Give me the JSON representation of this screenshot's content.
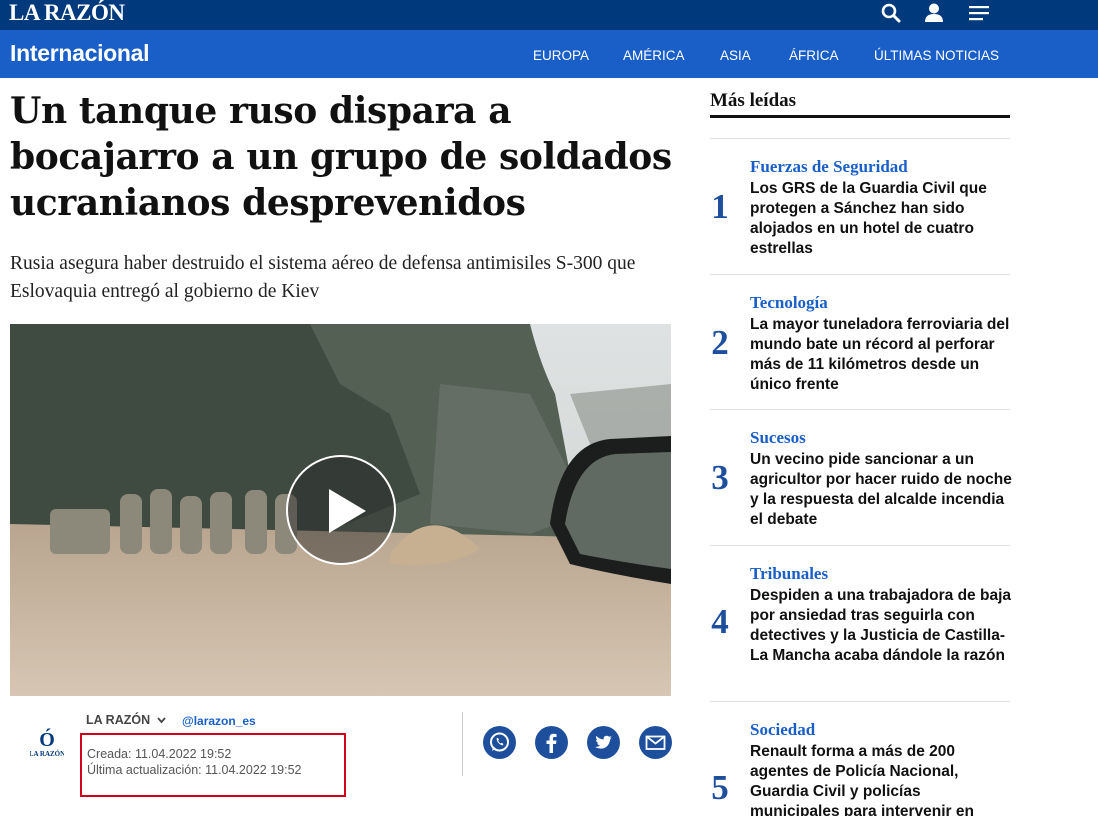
{
  "header": {
    "logo": "LA RAZÓN",
    "icons": [
      "search-icon",
      "user-icon",
      "menu-icon"
    ]
  },
  "section": {
    "title": "Internacional",
    "nav": [
      "EUROPA",
      "AMÉRICA",
      "ASIA",
      "ÁFRICA",
      "ÚLTIMAS NOTICIAS"
    ]
  },
  "article": {
    "headline": "Un tanque ruso dispara a bocajarro a un grupo de soldados ucranianos desprevenidos",
    "subtitle": "Rusia asegura haber destruido el sistema aéreo de defensa antimisiles S-300 que Eslovaquia entregó al gobierno de Kiev",
    "video_icon": "play-icon"
  },
  "byline": {
    "logo_letter": "Ó",
    "logo_text": "LA RAZÓN",
    "author": "LA RAZÓN",
    "handle": "@larazon_es",
    "created": "Creada: 11.04.2022 19:52",
    "updated": "Última actualización: 11.04.2022 19:52",
    "share_icons": [
      "whatsapp-icon",
      "facebook-icon",
      "twitter-icon",
      "email-icon"
    ]
  },
  "sidebar": {
    "title": "Más leídas",
    "items": [
      {
        "rank": "1",
        "category": "Fuerzas de Seguridad",
        "title": "Los GRS de la Guardia Civil que protegen a Sánchez han sido alojados en un hotel de cuatro estrellas"
      },
      {
        "rank": "2",
        "category": "Tecnología",
        "title": "La mayor tuneladora ferroviaria del mundo bate un récord al perforar más de 11 kilómetros desde un único frente"
      },
      {
        "rank": "3",
        "category": "Sucesos",
        "title": "Un vecino pide sancionar a un agricultor por hacer ruido de noche y la respuesta del alcalde incendia el debate"
      },
      {
        "rank": "4",
        "category": "Tribunales",
        "title": "Despiden a una trabajadora de baja por ansiedad tras seguirla con detectives y la Justicia de Castilla-La Mancha acaba dándole la razón"
      },
      {
        "rank": "5",
        "category": "Sociedad",
        "title": "Renault forma a más de 200 agentes de Policía Nacional, Guardia Civil y policías municipales para intervenir en"
      }
    ]
  },
  "colors": {
    "topbar": "#003a7d",
    "section_bar": "#1a5fc8",
    "accent": "#1e4f9c",
    "highlight_box": "#d0021b"
  }
}
